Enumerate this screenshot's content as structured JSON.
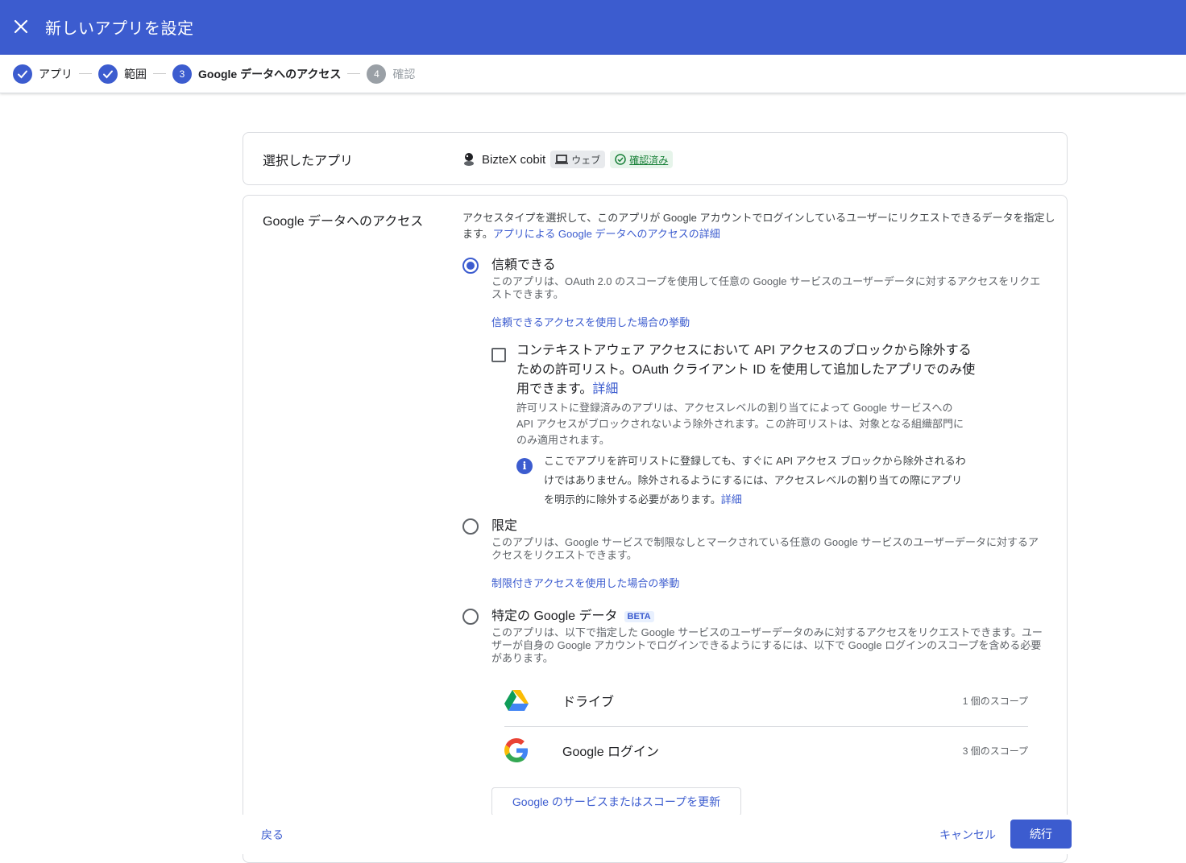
{
  "header": {
    "title": "新しいアプリを設定"
  },
  "stepper": {
    "steps": [
      {
        "number": "",
        "label": "アプリ"
      },
      {
        "number": "",
        "label": "範囲"
      },
      {
        "number": "3",
        "label": "Google データへのアクセス"
      },
      {
        "number": "4",
        "label": "確認"
      }
    ]
  },
  "selected_app": {
    "label": "選択したアプリ",
    "app_name": "BizteX cobit",
    "web_chip": "ウェブ",
    "verified_chip": "確認済み"
  },
  "access": {
    "label": "Google データへのアクセス",
    "intro": "アクセスタイプを選択して、このアプリが Google アカウントでログインしているユーザーにリクエストできるデータを指定します。",
    "intro_link": "アプリによる Google データへのアクセスの詳細",
    "trusted": {
      "title": "信頼できる",
      "desc": "このアプリは、OAuth 2.0 のスコープを使用して任意の Google サービスのユーザーデータに対するアクセスをリクエストできます。",
      "link": "信頼できるアクセスを使用した場合の挙動"
    },
    "allowlist": {
      "title": "コンテキストアウェア アクセスにおいて API アクセスのブロックから除外するための許可リスト。OAuth クライアント ID を使用して追加したアプリでのみ使用できます。",
      "title_link": "詳細",
      "desc": "許可リストに登録済みのアプリは、アクセスレベルの割り当てによって Google サービスへの API アクセスがブロックされないよう除外されます。この許可リストは、対象となる組織部門にのみ適用されます。",
      "info": "ここでアプリを許可リストに登録しても、すぐに API アクセス ブロックから除外されるわけではありません。除外されるようにするには、アクセスレベルの割り当ての際にアプリを明示的に除外する必要があります。",
      "info_link": "詳細"
    },
    "limited": {
      "title": "限定",
      "desc": "このアプリは、Google サービスで制限なしとマークされている任意の Google サービスのユーザーデータに対するアクセスをリクエストできます。",
      "link": "制限付きアクセスを使用した場合の挙動"
    },
    "specific": {
      "title": "特定の Google データ",
      "beta": "BETA",
      "desc": "このアプリは、以下で指定した Google サービスのユーザーデータのみに対するアクセスをリクエストできます。ユーザーが自身の Google アカウントでログインできるようにするには、以下で Google ログインのスコープを含める必要があります。"
    },
    "services": [
      {
        "name": "ドライブ",
        "scope": "1 個のスコープ",
        "icon": "google-drive-icon"
      },
      {
        "name": "Google ログイン",
        "scope": "3 個のスコープ",
        "icon": "google-g-icon"
      }
    ],
    "update_button": "Google のサービスまたはスコープを更新"
  },
  "footer": {
    "back": "戻る",
    "cancel": "キャンセル",
    "continue": "続行"
  }
}
